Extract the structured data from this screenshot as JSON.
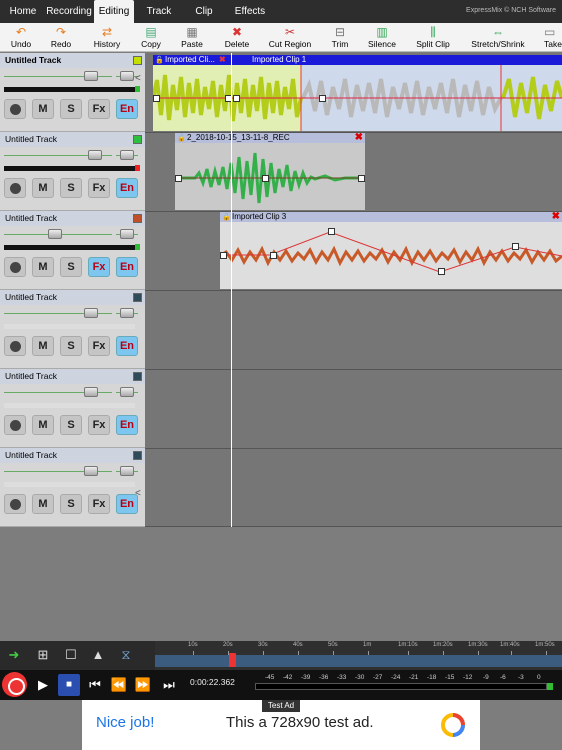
{
  "menu": {
    "tabs": [
      "Home",
      "Recording",
      "Editing",
      "Track",
      "Clip",
      "Effects"
    ],
    "active_tab": "Editing",
    "brand": "ExpressMix © NCH Software"
  },
  "toolbar": {
    "items": [
      "Undo",
      "Redo",
      "History",
      "Copy",
      "Paste",
      "Delete",
      "Cut Region",
      "Trim",
      "Silence",
      "Split Clip",
      "Stretch/Shrink",
      "Take"
    ]
  },
  "tracks": [
    {
      "name": "Untitled Track",
      "color": "#c5e000",
      "fx_active": false
    },
    {
      "name": "Untitled Track",
      "color": "#2fbf3f",
      "fx_active": false
    },
    {
      "name": "Untitled Track",
      "color": "#c0502a",
      "fx_active": true
    },
    {
      "name": "Untitled Track",
      "color": "#2f4a5a",
      "fx_active": false
    },
    {
      "name": "Untitled Track",
      "color": "#2f4a5a",
      "fx_active": false
    },
    {
      "name": "Untitled Track",
      "color": "#2f4a5a",
      "fx_active": false
    }
  ],
  "track_buttons": {
    "mute": "M",
    "solo": "S",
    "fx": "Fx",
    "en": "En"
  },
  "clips": {
    "clip1_name": "Imported Cli...",
    "clip1b_name": "Imported Clip 1",
    "clip2_name": "2_2018-10-15_13-11-8_REC",
    "clip3_name": "Imported Clip 3"
  },
  "ruler": {
    "labels": [
      "10s",
      "20s",
      "30s",
      "40s",
      "50s",
      "1m",
      "1m:10s",
      "1m:20s",
      "1m:30s",
      "1m:40s",
      "1m:50s"
    ]
  },
  "transport": {
    "time": "0:00:22.362",
    "vu_labels": [
      "-45",
      "-42",
      "-39",
      "-36",
      "-33",
      "-30",
      "-27",
      "-24",
      "-21",
      "-18",
      "-15",
      "-12",
      "-9",
      "-6",
      "-3",
      "0"
    ]
  },
  "ad": {
    "label": "Test Ad",
    "nice": "Nice job!",
    "text": "This a 728x90 test ad."
  }
}
